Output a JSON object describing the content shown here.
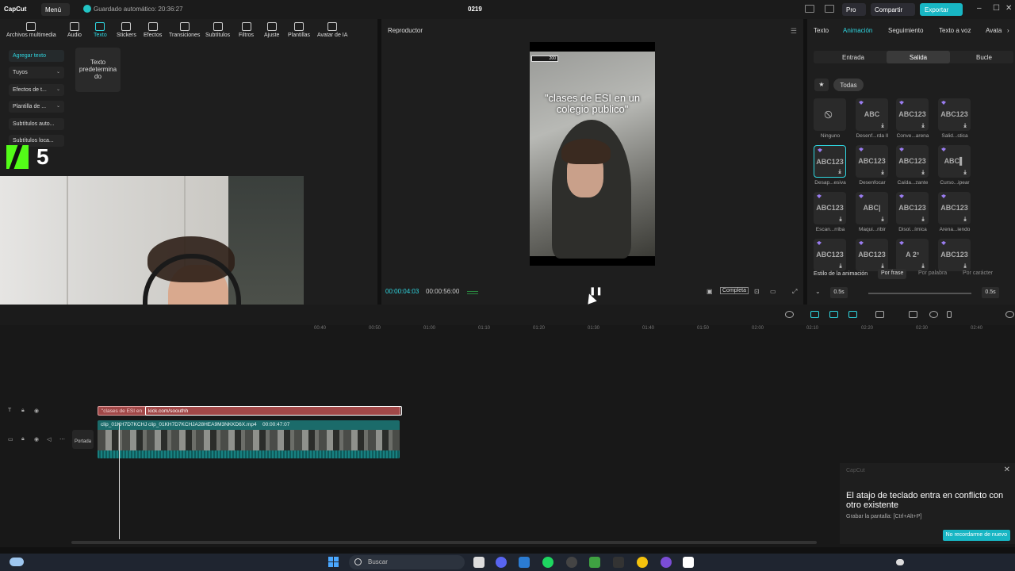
{
  "titlebar": {
    "logo": "CapCut",
    "menu": "Menú",
    "autosave": "Guardado automático: 20:36:27",
    "project": "0219",
    "pro": "Pro",
    "share": "Compartir",
    "export": "Exportar"
  },
  "toolbar": {
    "tabs": [
      "Archivos multimedia",
      "Audio",
      "Texto",
      "Stickers",
      "Efectos",
      "Transiciones",
      "Subtítulos",
      "Filtros",
      "Ajuste",
      "Plantillas",
      "Avatar de IA"
    ],
    "active": "Texto"
  },
  "sidebar": {
    "items": [
      "Agregar texto",
      "Tuyos",
      "Efectos de t...",
      "Plantilla de ...",
      "Subtítulos auto...",
      "Subtítulos loca..."
    ]
  },
  "text_card": "Texto predetermina do",
  "overlay": {
    "number": "5"
  },
  "player": {
    "title": "Reproductor",
    "video_tag": "200",
    "caption": "\"clases de ESI en un colegio publico\"",
    "current_time": "00:00:04:03",
    "total_time": "00:00:56:00",
    "completa": "Completa"
  },
  "right_panel": {
    "tabs": [
      "Texto",
      "Animación",
      "Seguimiento",
      "Texto a voz",
      "Avata"
    ],
    "active_tab": "Animación",
    "sub_tabs": [
      "Entrada",
      "Salida",
      "Bucle"
    ],
    "active_sub": "Salida",
    "filter_all": "Todas",
    "effects": [
      {
        "label": "Ninguno",
        "thumb": "⃠"
      },
      {
        "label": "Desenf...rda II",
        "thumb": "ABC"
      },
      {
        "label": "Conve...arena",
        "thumb": "ABC123"
      },
      {
        "label": "Salid...stica",
        "thumb": "ABC123"
      },
      {
        "label": "Desap...esiva",
        "thumb": "ABC123"
      },
      {
        "label": "Desenfocar",
        "thumb": "ABC123"
      },
      {
        "label": "Caída...zante",
        "thumb": "ABC123"
      },
      {
        "label": "Curso...ipear",
        "thumb": "ABC▌"
      },
      {
        "label": "Escan...rriba",
        "thumb": "ABC123"
      },
      {
        "label": "Maqui...ribir",
        "thumb": "ABC|"
      },
      {
        "label": "Disol...ímica",
        "thumb": "ABC123"
      },
      {
        "label": "Arena...iendo",
        "thumb": "ABC123"
      },
      {
        "label": "",
        "thumb": "ABC123"
      },
      {
        "label": "",
        "thumb": "ABC123"
      },
      {
        "label": "",
        "thumb": "A  2³"
      },
      {
        "label": "",
        "thumb": "ABC123"
      }
    ],
    "style_label": "Estilo de la animación",
    "style_options": [
      "Por frase",
      "Por palabra",
      "Por carácter"
    ],
    "active_style": "Por frase",
    "duration_start": "0.5s",
    "duration_end": "0.5s"
  },
  "timeline": {
    "ruler": [
      "00:40",
      "00:50",
      "01:00",
      "01:10",
      "01:20",
      "01:30",
      "01:40",
      "01:50",
      "02:00",
      "02:10",
      "02:20",
      "02:30",
      "02:40"
    ],
    "text_clip": "\"clases de ESI en",
    "text_clip_2": "kick.com/soouthh",
    "video_clip_1": "clip_01KH7D7KCHJ",
    "video_clip_2": "clip_01KH7D7KCHJA28HEA9M3NKKD6X.mp4",
    "video_clip_duration": "00:00:47:07",
    "cover": "Portada"
  },
  "notification": {
    "app": "CapCut",
    "title": "El atajo de teclado entra en conflicto con otro existente",
    "body": "Grabar la pantalla: [Ctrl+Alt+P]",
    "button": "No recordarme de nuevo"
  },
  "taskbar": {
    "search": "Buscar"
  }
}
